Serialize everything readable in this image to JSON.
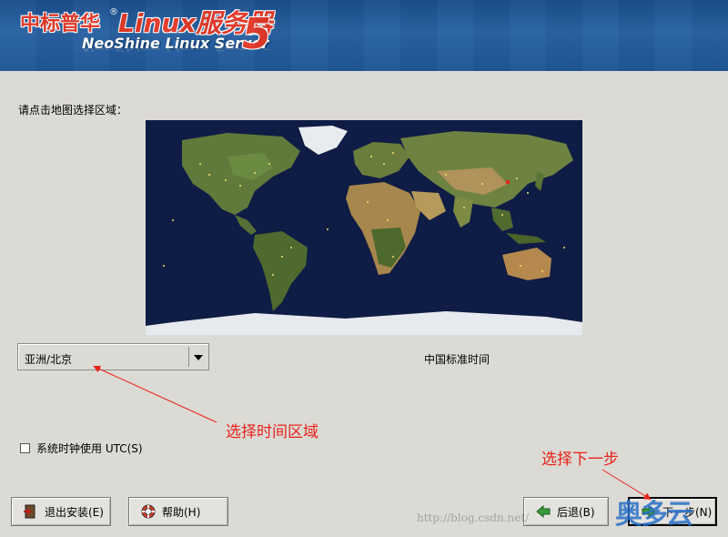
{
  "header": {
    "brand_cn": "中标普华",
    "brand_reg": "®",
    "brand_linux": "Linux服务器",
    "brand_en": "NeoShine Linux Server",
    "brand_version": "5"
  },
  "prompt_label": "请点击地图选择区域：",
  "timezone": {
    "selected": "亚洲/北京",
    "description": "中国标准时间"
  },
  "utc_checkbox": {
    "label": "系统时钟使用 UTC(S)",
    "checked": false
  },
  "buttons": {
    "exit": "退出安装(E)",
    "help": "帮助(H)",
    "back": "后退(B)",
    "next": "下一步(N)"
  },
  "annotations": {
    "select_zone": "选择时间区域",
    "select_next": "选择下一步"
  },
  "watermark": {
    "url": "http://blog.csdn.net/",
    "logo": "奥多云"
  },
  "colors": {
    "annotation": "#e8231a",
    "banner": "#2a63a3",
    "map_ocean": "#0f1c45"
  }
}
